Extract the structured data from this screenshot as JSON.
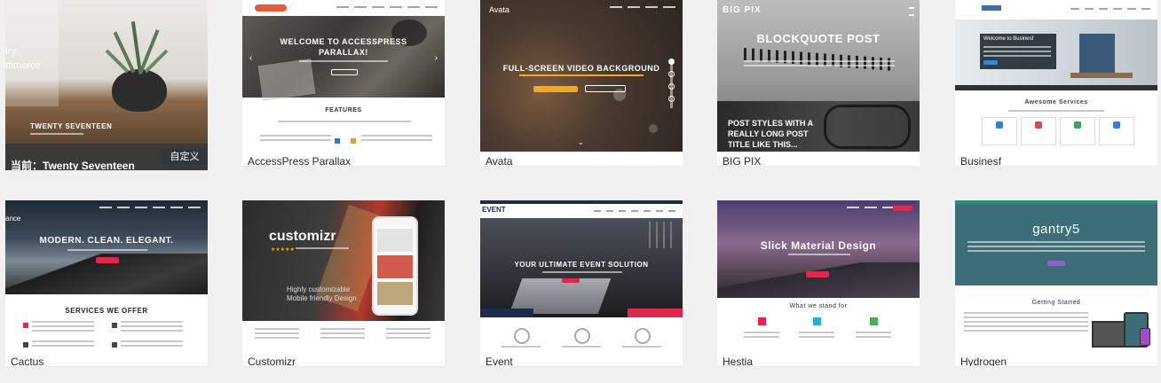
{
  "themes": {
    "twentyseventeen": {
      "caption": "当前：Twenty Seventeen",
      "shot_title": "TWENTY SEVENTEEN",
      "shot_left1": "try",
      "shot_left2": "mmerce",
      "badge": "自定义"
    },
    "accesspress": {
      "caption": "AccessPress Parallax",
      "hero_line1": "WELCOME TO ACCESSPRESS",
      "hero_line2": "PARALLAX!",
      "section_title": "FEATURES"
    },
    "avata": {
      "caption": "Avata",
      "logo": "Avata",
      "hero": "FULL-SCREEN VIDEO BACKGROUND"
    },
    "bigpix": {
      "caption": "BIG PIX",
      "logo": "BIG PIX",
      "hero": "BLOCKQUOTE POST",
      "post_line1": "POST STYLES WITH A",
      "post_line2": "REALLY LONG POST",
      "post_line3": "TITLE LIKE THIS..."
    },
    "businessf": {
      "caption": "Businesf",
      "welcome": "Welcome to Businesf",
      "services": "Awesome Services"
    },
    "cactus": {
      "caption": "Cactus",
      "hero": "MODERN. CLEAN. ELEGANT.",
      "services": "SERVICES WE OFFER",
      "left_frag": "ance"
    },
    "customizr": {
      "caption": "Customizr",
      "logo": "customizr",
      "tag1": "Highly customizable",
      "tag2": "Mobile friendly Design"
    },
    "event": {
      "caption": "Event",
      "logo": "EVENT",
      "hero": "YOUR ULTIMATE EVENT SOLUTION"
    },
    "hestia": {
      "caption": "Hestia",
      "hero": "Slick Material Design",
      "section": "What we stand for"
    },
    "hydrogen": {
      "caption": "Hydrogen",
      "logo": "gantry5",
      "section": "Getting Started"
    }
  },
  "colors": {
    "accent_orange": "#f5a623",
    "accent_red": "#e0284a",
    "gantry_teal": "#3d6d76",
    "badge_bg": "#23282d"
  }
}
